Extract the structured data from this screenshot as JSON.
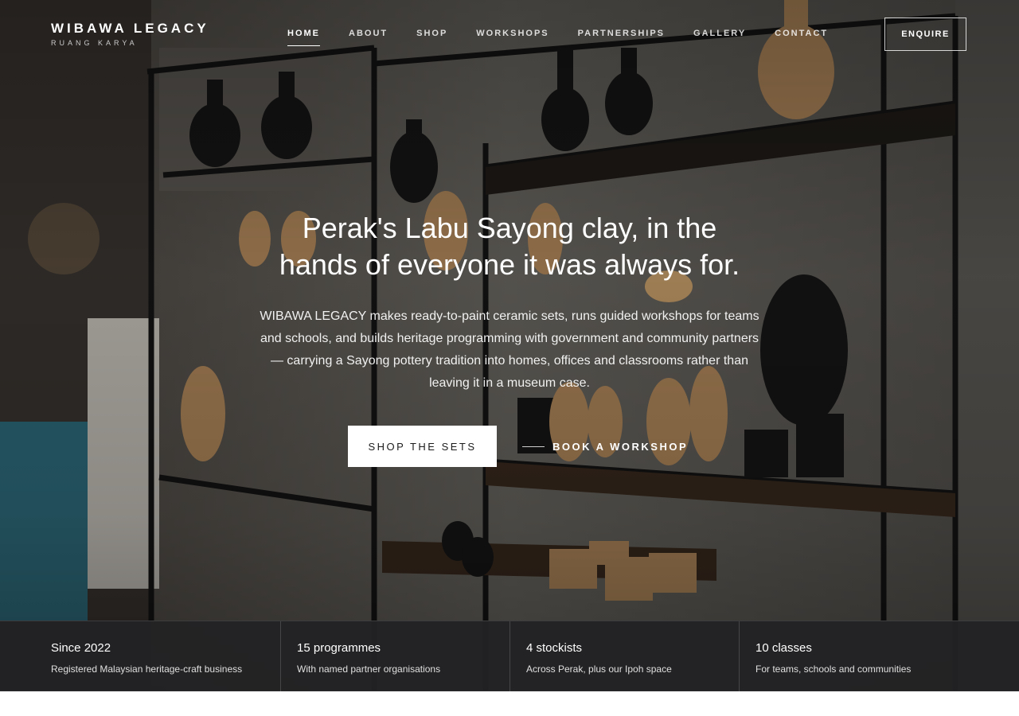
{
  "brand": {
    "name": "WIBAWA LEGACY",
    "tagline": "RUANG KARYA"
  },
  "nav": {
    "items": [
      {
        "label": "HOME",
        "active": true
      },
      {
        "label": "ABOUT"
      },
      {
        "label": "SHOP"
      },
      {
        "label": "WORKSHOPS"
      },
      {
        "label": "PARTNERSHIPS"
      },
      {
        "label": "GALLERY"
      },
      {
        "label": "CONTACT"
      }
    ],
    "cta": "ENQUIRE"
  },
  "hero": {
    "title_line1": "Perak's Labu Sayong clay, in the",
    "title_line2": "hands of everyone it was always for.",
    "body": "WIBAWA LEGACY makes ready-to-paint ceramic sets, runs guided workshops for teams and schools, and builds heritage programming with government and community partners — carrying a Sayong pottery tradition into homes, offices and classrooms rather than leaving it in a museum case.",
    "primary_button": "SHOP THE SETS",
    "secondary_link": "BOOK A WORKSHOP",
    "background_image": "photo of pottery shop shelves with black and terracotta Labu Sayong vessels"
  },
  "stats": [
    {
      "value": "Since 2022",
      "label": "Registered Malaysian heritage-craft business"
    },
    {
      "value": "15 programmes",
      "label": "With named partner organisations"
    },
    {
      "value": "4 stockists",
      "label": "Across Perak, plus our Ipoh space"
    },
    {
      "value": "10 classes",
      "label": "For teams, schools and communities"
    }
  ],
  "colors": {
    "stats_bar": "#222224",
    "primary_button_bg": "#ffffff",
    "text_light": "#ffffff"
  }
}
